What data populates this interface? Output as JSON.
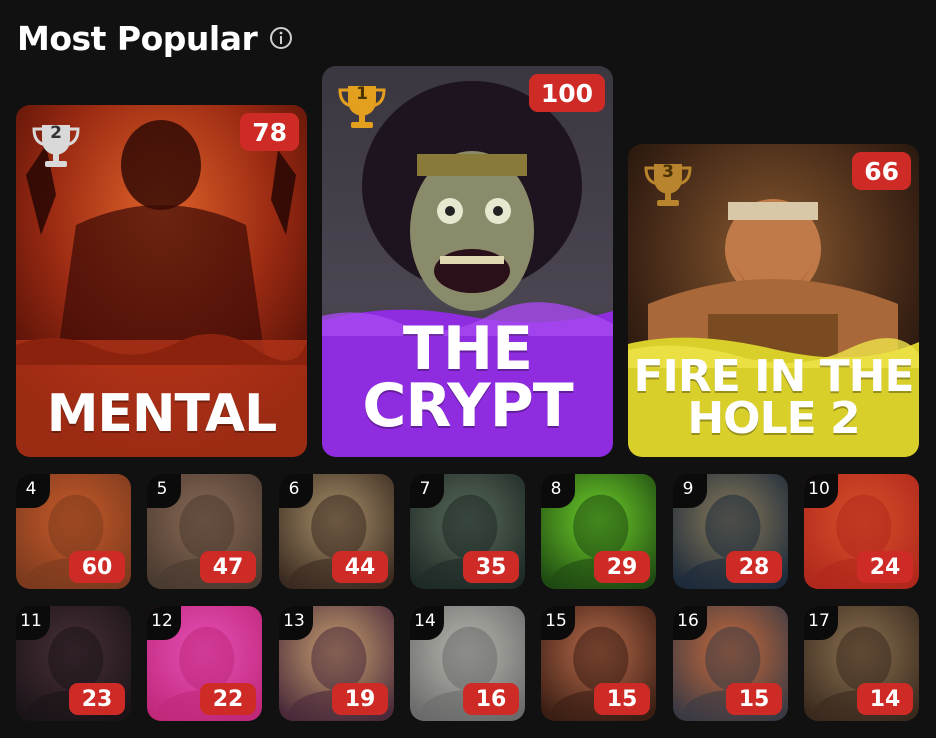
{
  "section": {
    "title": "Most Popular",
    "info_icon": "info-icon"
  },
  "podium": [
    {
      "rank": "2",
      "trophy": "silver",
      "score": "78",
      "title": "MENTAL",
      "colors": {
        "bg": "#8c2310",
        "accent": "#d24a1e"
      }
    },
    {
      "rank": "1",
      "trophy": "gold",
      "score": "100",
      "title": "THE CRYPT",
      "title_lines": [
        "THE",
        "CRYPT"
      ],
      "colors": {
        "bg": "#3b3540",
        "accent": "#8f2ce0"
      }
    },
    {
      "rank": "3",
      "trophy": "bronze",
      "score": "66",
      "title": "FIRE IN THE HOLE 2",
      "title_lines": [
        "FIRE IN THE",
        "HOLE 2"
      ],
      "colors": {
        "bg": "#5a3420",
        "accent": "#d8cf2a"
      }
    }
  ],
  "tiles": [
    {
      "rank": "4",
      "score": "60",
      "colors": [
        "#7b3a1e",
        "#c85a2a"
      ]
    },
    {
      "rank": "5",
      "score": "47",
      "colors": [
        "#4a3a30",
        "#8a6a55"
      ]
    },
    {
      "rank": "6",
      "score": "44",
      "colors": [
        "#3a2a20",
        "#a8906a"
      ]
    },
    {
      "rank": "7",
      "score": "35",
      "colors": [
        "#1e2a26",
        "#5a6a5a"
      ]
    },
    {
      "rank": "8",
      "score": "29",
      "colors": [
        "#1f4a12",
        "#6fd12a"
      ]
    },
    {
      "rank": "9",
      "score": "28",
      "colors": [
        "#1c2a3a",
        "#8a7a5a"
      ]
    },
    {
      "rank": "10",
      "score": "24",
      "colors": [
        "#b0281c",
        "#d8502a"
      ]
    },
    {
      "rank": "11",
      "score": "23",
      "colors": [
        "#1a1418",
        "#4a3038"
      ]
    },
    {
      "rank": "12",
      "score": "22",
      "colors": [
        "#c0287a",
        "#e650b8"
      ]
    },
    {
      "rank": "13",
      "score": "19",
      "colors": [
        "#4a2a3a",
        "#c8a070"
      ]
    },
    {
      "rank": "14",
      "score": "16",
      "colors": [
        "#6a6a6a",
        "#b8b8b0"
      ]
    },
    {
      "rank": "15",
      "score": "15",
      "colors": [
        "#3a1e14",
        "#b86a4a"
      ]
    },
    {
      "rank": "16",
      "score": "15",
      "colors": [
        "#3a3a44",
        "#c86a3a"
      ]
    },
    {
      "rank": "17",
      "score": "14",
      "colors": [
        "#3a2a1e",
        "#8a7050"
      ]
    }
  ]
}
